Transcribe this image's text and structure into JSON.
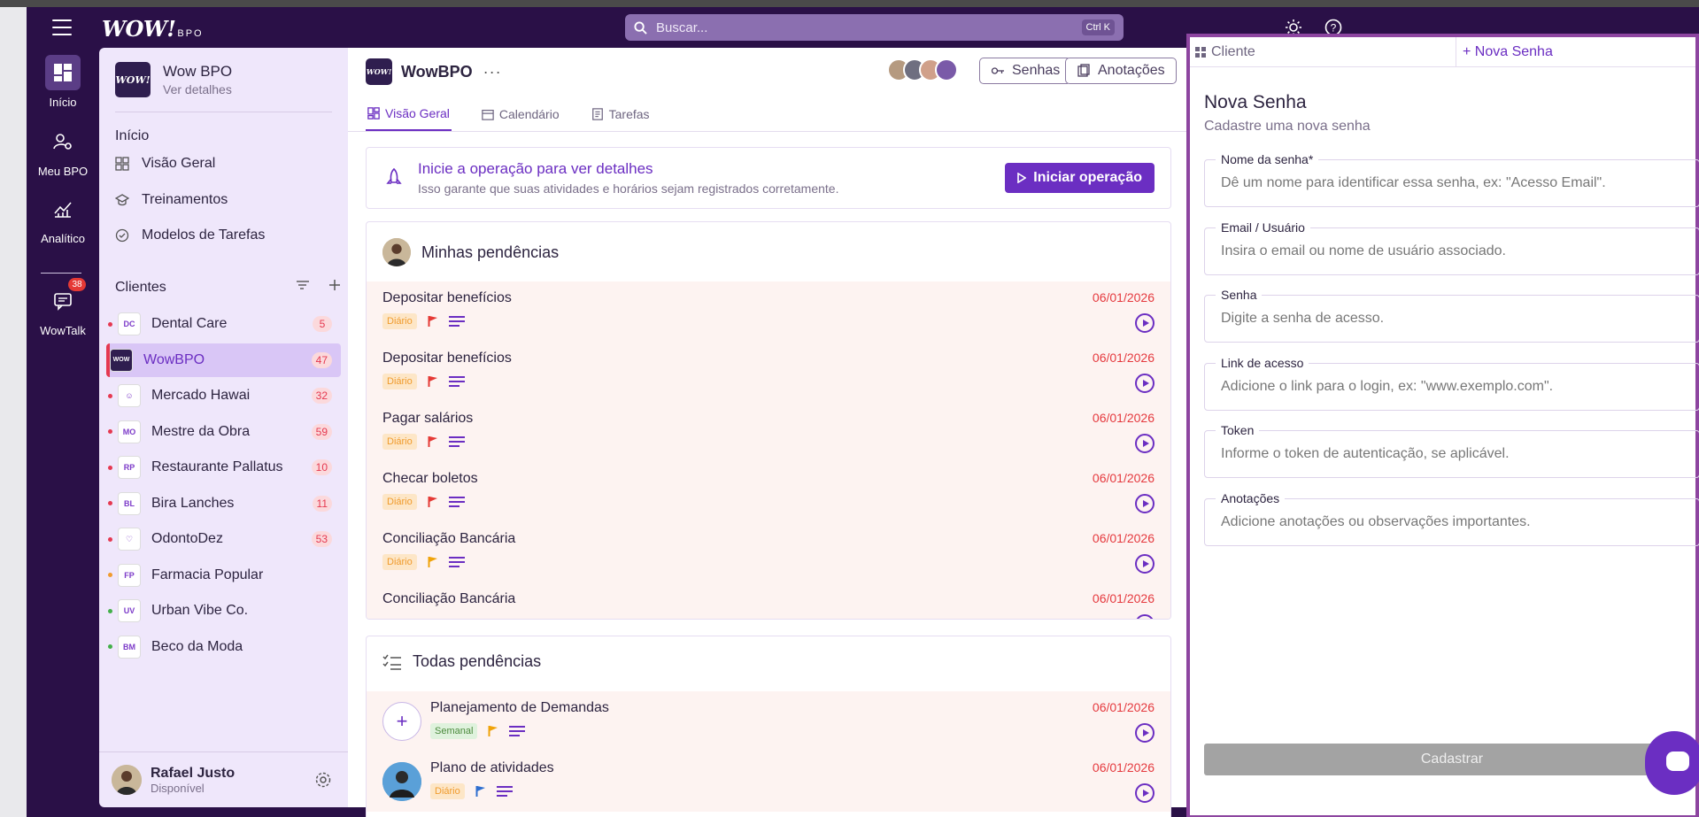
{
  "app": {
    "brand": "WOW!",
    "brand_suffix": "BPO",
    "search_placeholder": "Buscar...",
    "search_shortcut": "Ctrl K"
  },
  "rail": [
    {
      "label": "Início",
      "icon": "dashboard-icon"
    },
    {
      "label": "Meu BPO",
      "icon": "user-gear-icon"
    },
    {
      "label": "Analítico",
      "icon": "chart-icon"
    },
    {
      "label": "WowTalk",
      "icon": "chat-icon",
      "badge": "38"
    }
  ],
  "sidebar": {
    "org_name": "Wow BPO",
    "org_sub": "Ver detalhes",
    "section_inicio": "Início",
    "links": [
      "Visão Geral",
      "Treinamentos",
      "Modelos de Tarefas"
    ],
    "section_clientes": "Clientes",
    "clients": [
      {
        "name": "Dental Care",
        "count": "5",
        "dot": "#e53950",
        "logo": "DC"
      },
      {
        "name": "WowBPO",
        "count": "47",
        "dot": "#e53950",
        "logo": "WOW"
      },
      {
        "name": "Mercado Hawai",
        "count": "32",
        "dot": "#e53950",
        "logo": "☺"
      },
      {
        "name": "Mestre da Obra",
        "count": "59",
        "dot": "#e53950",
        "logo": "MO"
      },
      {
        "name": "Restaurante Pallatus",
        "count": "10",
        "dot": "#e53950",
        "logo": "RP"
      },
      {
        "name": "Bira Lanches",
        "count": "11",
        "dot": "#e53950",
        "logo": "BL"
      },
      {
        "name": "OdontoDez",
        "count": "53",
        "dot": "#e53950",
        "logo": "♡"
      },
      {
        "name": "Farmacia Popular",
        "count": "",
        "dot": "#f09b2d",
        "logo": "FP"
      },
      {
        "name": "Urban Vibe Co.",
        "count": "",
        "dot": "#43b049",
        "logo": "UV"
      },
      {
        "name": "Beco da Moda",
        "count": "",
        "dot": "#43b049",
        "logo": "BM"
      }
    ],
    "user_name": "Rafael Justo",
    "user_status": "Disponível"
  },
  "main": {
    "title": "WowBPO",
    "btn_senhas": "Senhas",
    "btn_anotacoes": "Anotações",
    "tabs": [
      "Visão Geral",
      "Calendário",
      "Tarefas"
    ],
    "operation": {
      "title": "Inicie a operação para ver detalhes",
      "subtitle": "Isso garante que suas atividades e horários sejam registrados corretamente.",
      "button": "Iniciar operação"
    },
    "minhas_title": "Minhas pendências",
    "minhas": [
      {
        "name": "Depositar benefícios",
        "date": "06/01/2026",
        "tag": "Diário",
        "flag": "#e53935"
      },
      {
        "name": "Depositar benefícios",
        "date": "06/01/2026",
        "tag": "Diário",
        "flag": "#e53935"
      },
      {
        "name": "Pagar salários",
        "date": "06/01/2026",
        "tag": "Diário",
        "flag": "#e53935"
      },
      {
        "name": "Checar boletos",
        "date": "06/01/2026",
        "tag": "Diário",
        "flag": "#e53935"
      },
      {
        "name": "Conciliação Bancária",
        "date": "06/01/2026",
        "tag": "Diário",
        "flag": "#f0a30a"
      },
      {
        "name": "Conciliação Bancária",
        "date": "06/01/2026",
        "tag": "",
        "flag": ""
      }
    ],
    "todas_title": "Todas pendências",
    "todas": [
      {
        "name": "Planejamento de Demandas",
        "date": "06/01/2026",
        "tag": "Semanal",
        "flag": "#f0a30a"
      },
      {
        "name": "Plano de atividades",
        "date": "06/01/2026",
        "tag": "Diário",
        "flag": "#2f6fd0"
      }
    ]
  },
  "panel": {
    "tab_cliente": "Cliente",
    "tab_nova": "+ Nova Senha",
    "title": "Nova Senha",
    "subtitle": "Cadastre uma nova senha",
    "fields": [
      {
        "label": "Nome da senha*",
        "placeholder": "Dê um nome para identificar essa senha, ex: \"Acesso Email\"."
      },
      {
        "label": "Email / Usuário",
        "placeholder": "Insira o email ou nome de usuário associado."
      },
      {
        "label": "Senha",
        "placeholder": "Digite a senha de acesso."
      },
      {
        "label": "Link de acesso",
        "placeholder": "Adicione o link para o login, ex: \"www.exemplo.com\"."
      },
      {
        "label": "Token",
        "placeholder": "Informe o token de autenticação, se aplicável."
      },
      {
        "label": "Anotações",
        "placeholder": "Adicione anotações ou observações importantes."
      }
    ],
    "submit": "Cadastrar"
  },
  "colors": {
    "accent": "#6b2ec2",
    "topbar": "#2a1047",
    "danger": "#e53950"
  }
}
